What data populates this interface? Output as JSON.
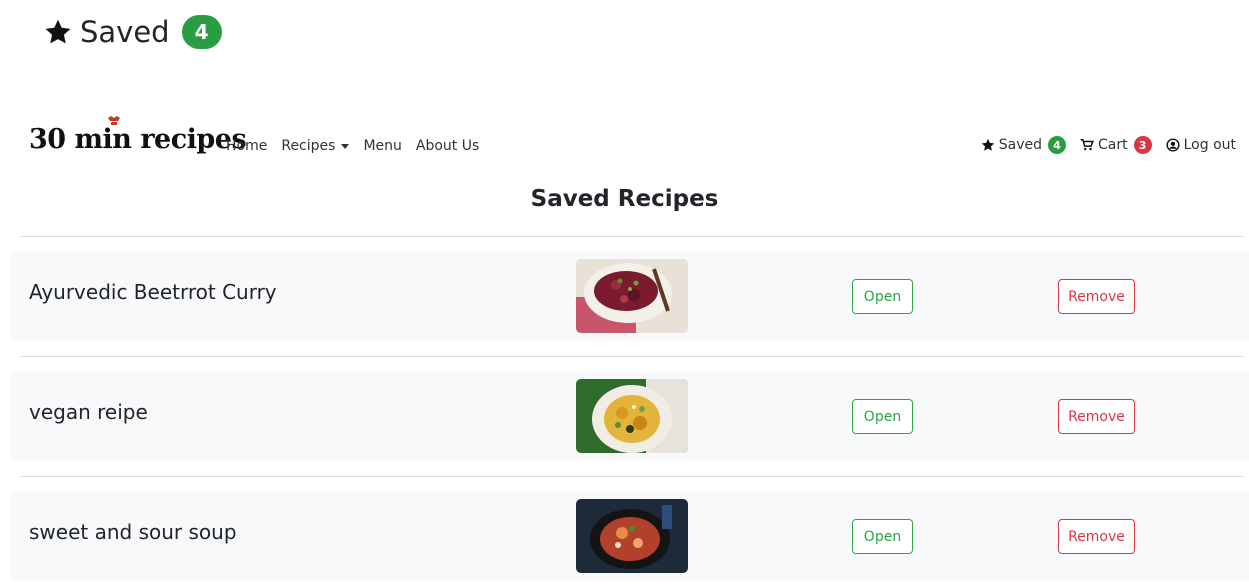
{
  "callout": {
    "label": "Saved",
    "count": "4"
  },
  "navbar": {
    "brand": "30 min recipes",
    "links": [
      {
        "label": "Home"
      },
      {
        "label": "Recipes"
      },
      {
        "label": "Menu"
      },
      {
        "label": "About Us"
      }
    ],
    "saved_label": "Saved",
    "saved_count": "4",
    "cart_label": "Cart",
    "cart_count": "3",
    "logout_label": "Log out"
  },
  "page": {
    "title": "Saved Recipes"
  },
  "recipes": [
    {
      "name": "Ayurvedic Beetrrot Curry",
      "open_label": "Open",
      "remove_label": "Remove"
    },
    {
      "name": "vegan reipe",
      "open_label": "Open",
      "remove_label": "Remove"
    },
    {
      "name": "sweet and sour soup",
      "open_label": "Open",
      "remove_label": "Remove"
    }
  ],
  "icons": {
    "star": "star-icon",
    "cart": "cart-icon",
    "user": "user-circle-icon",
    "caret": "caret-down-icon",
    "brand": "chef-hat-icon"
  },
  "colors": {
    "success": "#28a745",
    "danger": "#dc3545",
    "badge_green": "#2a9d42",
    "row_bg": "#f8f9fa"
  }
}
